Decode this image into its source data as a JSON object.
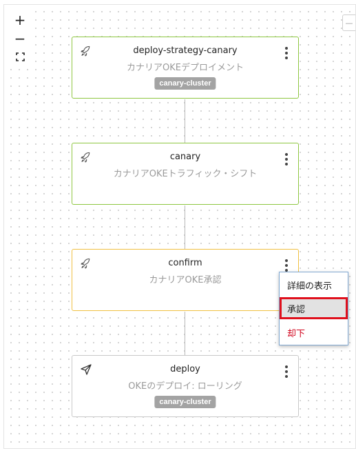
{
  "zoom_controls": {
    "zoom_in_label": "+",
    "zoom_out_label": "−"
  },
  "minimap_toggle_label": "—",
  "nodes": [
    {
      "title": "deploy-strategy-canary",
      "subtitle": "カナリアOKEデプロイメント",
      "badge": "canary-cluster",
      "icon": "rocket-icon",
      "status_color": "#8dc63f"
    },
    {
      "title": "canary",
      "subtitle": "カナリアOKEトラフィック・シフト",
      "badge": "",
      "icon": "rocket-icon",
      "status_color": "#8dc63f"
    },
    {
      "title": "confirm",
      "subtitle": "カナリアOKE承認",
      "badge": "",
      "icon": "rocket-icon",
      "status_color": "#f0c040"
    },
    {
      "title": "deploy",
      "subtitle": "OKEのデプロイ: ローリング",
      "badge": "canary-cluster",
      "icon": "send-icon",
      "status_color": "#c8c8c8"
    }
  ],
  "context_menu": {
    "items": [
      {
        "label": "詳細の表示"
      },
      {
        "label": "承認"
      },
      {
        "label": "却下"
      }
    ],
    "highlight_color": "#e0101c",
    "danger_color": "#d0021b"
  }
}
